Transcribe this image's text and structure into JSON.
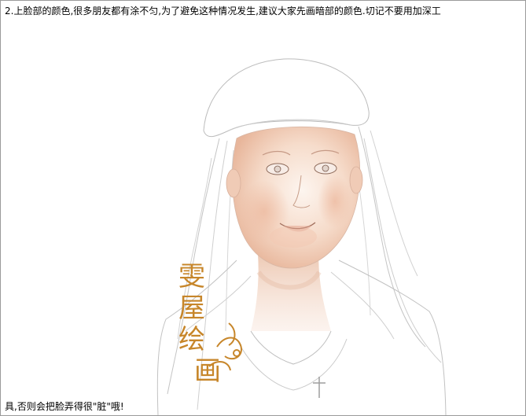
{
  "captions": {
    "top": "2.上脸部的颜色,很多朋友都有涂不匀,为了避免这种情况发生,建议大家先画暗部的颜色.切记不要用加深工",
    "bottom": "具,否则会把脸弄得很\"脏\"哦!"
  },
  "watermark": {
    "text": "雯屋绘画"
  },
  "colors": {
    "skin_shadow": "#e9b89e",
    "skin_light": "#fbeee6",
    "line": "#b5b5b5",
    "watermark_gold": "#c7862a"
  }
}
